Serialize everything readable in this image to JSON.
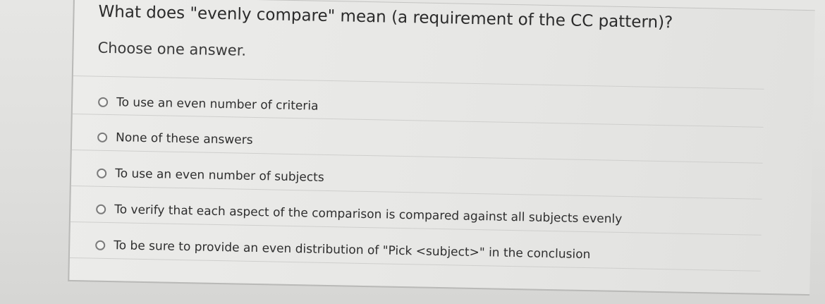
{
  "question": {
    "text": "What does \"evenly compare\" mean (a requirement of the CC pattern)?",
    "instruction": "Choose one answer."
  },
  "options": [
    {
      "label": "To use an even number of criteria",
      "selected": false
    },
    {
      "label": "None of these answers",
      "selected": false
    },
    {
      "label": "To use an even number of subjects",
      "selected": false
    },
    {
      "label": "To verify that each aspect of the comparison is compared against all subjects evenly",
      "selected": false
    },
    {
      "label": "To be sure to provide an even distribution of \"Pick <subject>\" in the conclusion",
      "selected": false
    }
  ]
}
